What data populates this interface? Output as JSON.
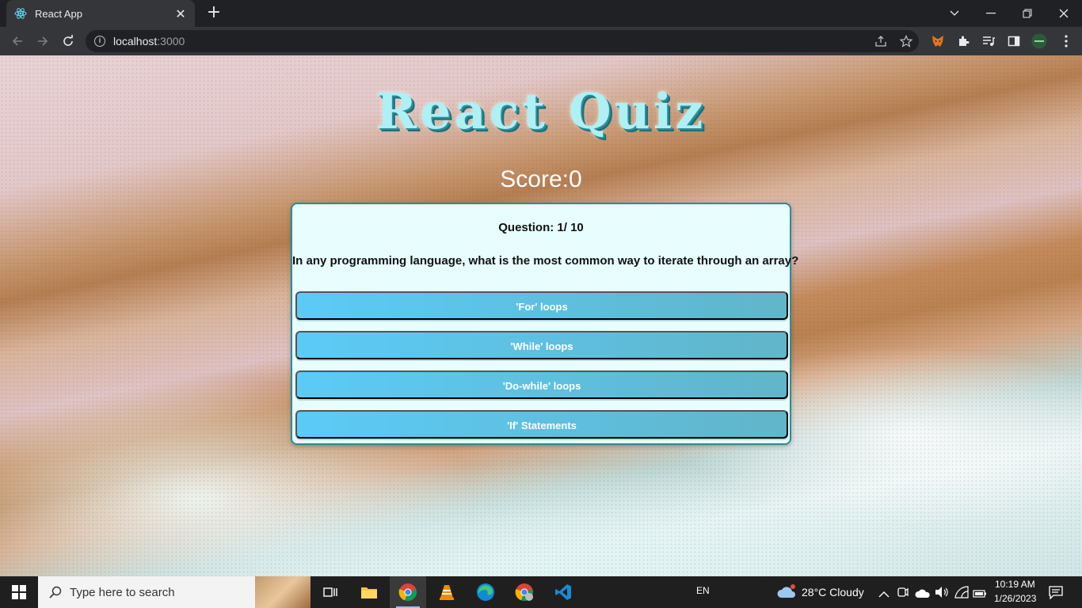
{
  "browser": {
    "tab_title": "React App",
    "url_host": "localhost",
    "url_port": ":3000"
  },
  "page": {
    "title": "React Quiz",
    "score_label": "Score:",
    "score_value": "0",
    "question_counter": "Question: 1/ 10",
    "question_text": "In any programming language, what is the most common way to iterate through an array?",
    "answers": [
      "'For' loops",
      "'While' loops",
      "'Do-while' loops",
      "'If' Statements"
    ]
  },
  "taskbar": {
    "search_placeholder": "Type here to search",
    "language": "EN",
    "weather": "28°C  Cloudy",
    "time": "10:19 AM",
    "date": "1/26/2023"
  },
  "colors": {
    "answer_gradient_start": "#5bcbf7",
    "answer_gradient_end": "#61b5c9",
    "card_border": "#2b8c96",
    "card_bg": "#e8fdfe"
  }
}
